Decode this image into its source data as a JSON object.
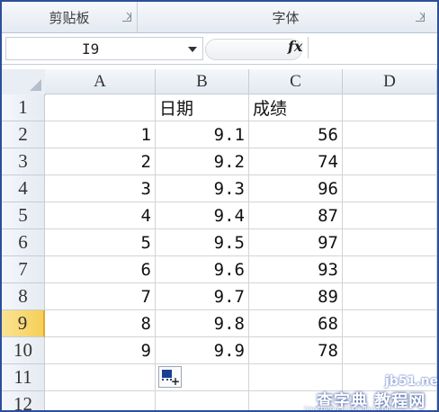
{
  "ribbon": {
    "groups": [
      {
        "label": "剪贴板"
      },
      {
        "label": "字体"
      }
    ]
  },
  "formula_bar": {
    "name_box_value": "I9",
    "fx_label": "fx",
    "formula_value": ""
  },
  "columns": [
    "A",
    "B",
    "C",
    "D"
  ],
  "rows": [
    {
      "label": "1",
      "cells": [
        "",
        "日期",
        "成绩",
        ""
      ]
    },
    {
      "label": "2",
      "cells": [
        "1",
        "9.1",
        "56",
        ""
      ]
    },
    {
      "label": "3",
      "cells": [
        "2",
        "9.2",
        "74",
        ""
      ]
    },
    {
      "label": "4",
      "cells": [
        "3",
        "9.3",
        "96",
        ""
      ]
    },
    {
      "label": "5",
      "cells": [
        "4",
        "9.4",
        "87",
        ""
      ]
    },
    {
      "label": "6",
      "cells": [
        "5",
        "9.5",
        "97",
        ""
      ]
    },
    {
      "label": "7",
      "cells": [
        "6",
        "9.6",
        "93",
        ""
      ]
    },
    {
      "label": "8",
      "cells": [
        "7",
        "9.7",
        "89",
        ""
      ]
    },
    {
      "label": "9",
      "cells": [
        "8",
        "9.8",
        "68",
        ""
      ]
    },
    {
      "label": "10",
      "cells": [
        "9",
        "9.9",
        "78",
        ""
      ]
    },
    {
      "label": "11",
      "cells": [
        "",
        "",
        "",
        ""
      ]
    },
    {
      "label": "12",
      "cells": [
        "",
        "",
        "",
        ""
      ]
    }
  ],
  "selected_row": "9",
  "watermark": {
    "line1": "jb51.net",
    "line2": "查字典 教程网",
    "line3": "jiaocheng.chazidian.com"
  }
}
